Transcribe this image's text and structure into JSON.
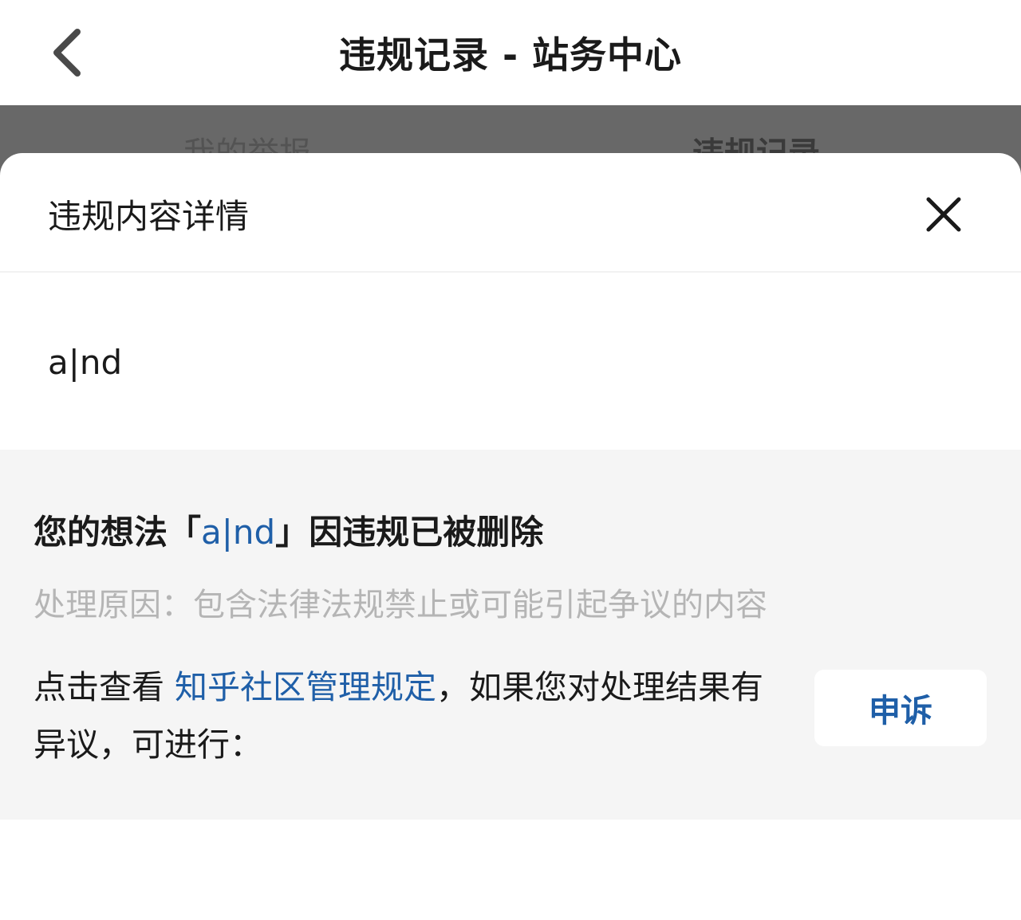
{
  "nav": {
    "title": "违规记录 - 站务中心",
    "back_icon": "chevron-left-icon"
  },
  "background_tabs": [
    "我的举报",
    "违规记录"
  ],
  "sheet": {
    "title": "违规内容详情",
    "close_icon": "close-icon",
    "content": "a|nd",
    "heading_prefix": "您的想法「",
    "heading_highlight": "a|nd",
    "heading_suffix": "」因违规已被删除",
    "reason": "处理原因：包含法律法规禁止或可能引起争议的内容",
    "notice_prefix": "点击查看 ",
    "notice_link": "知乎社区管理规定",
    "notice_suffix": "，如果您对处理结果有异议，可进行：",
    "appeal_label": "申诉"
  },
  "colors": {
    "link": "#1f5fa8",
    "overlay": "#686868",
    "panel_bg": "#f5f5f5",
    "reason_text": "#b5b5b5"
  }
}
